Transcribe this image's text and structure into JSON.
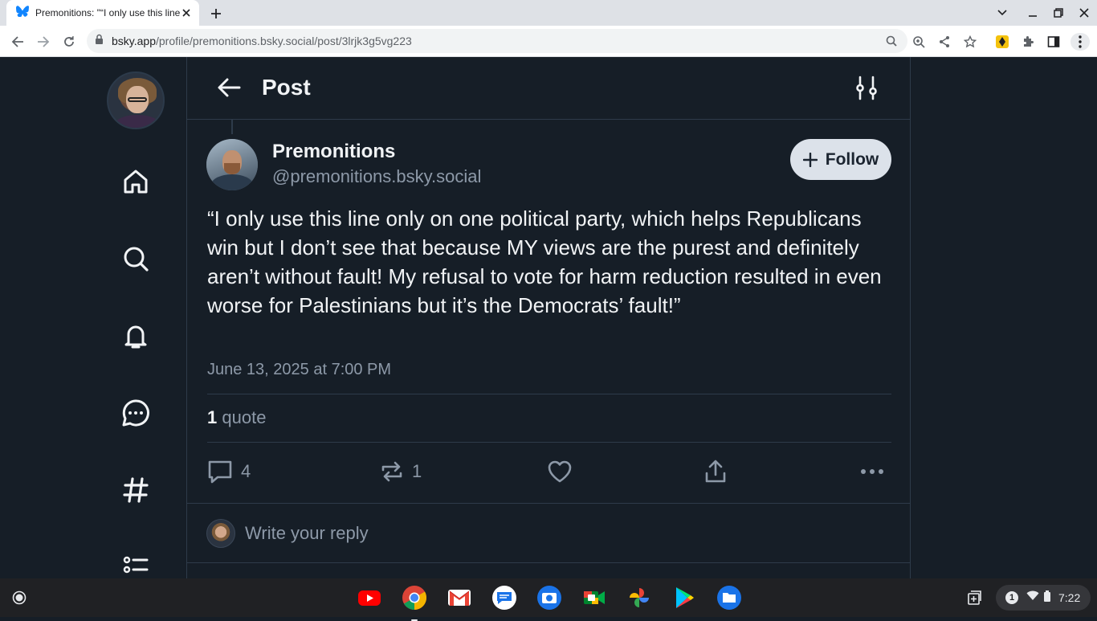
{
  "browser": {
    "tab_title": "Premonitions: \"“I only use this line",
    "url_domain": "bsky.app",
    "url_path": "/profile/premonitions.bsky.social/post/3lrjk3g5vg223"
  },
  "header": {
    "title": "Post"
  },
  "post": {
    "author_name": "Premonitions",
    "author_handle": "@premonitions.bsky.social",
    "follow_label": "Follow",
    "text": "“I only use this line only on one political party, which helps Republicans win but I don’t see that because MY views are the purest and definitely aren’t without fault! My refusal to vote for harm reduction resulted in even worse for Palestinians but it’s the Democrats’ fault!”",
    "timestamp": "June 13, 2025 at 7:00 PM",
    "quote_count": "1",
    "quote_label": "quote",
    "reply_count": "4",
    "repost_count": "1"
  },
  "reply": {
    "placeholder": "Write your reply"
  },
  "shelf": {
    "notification_count": "1",
    "time": "7:22"
  },
  "colors": {
    "background": "#161e27",
    "text": "#f1f3f5",
    "muted": "#8d99a8",
    "border": "#2e3b4a",
    "follow_bg": "#dce2ea"
  }
}
